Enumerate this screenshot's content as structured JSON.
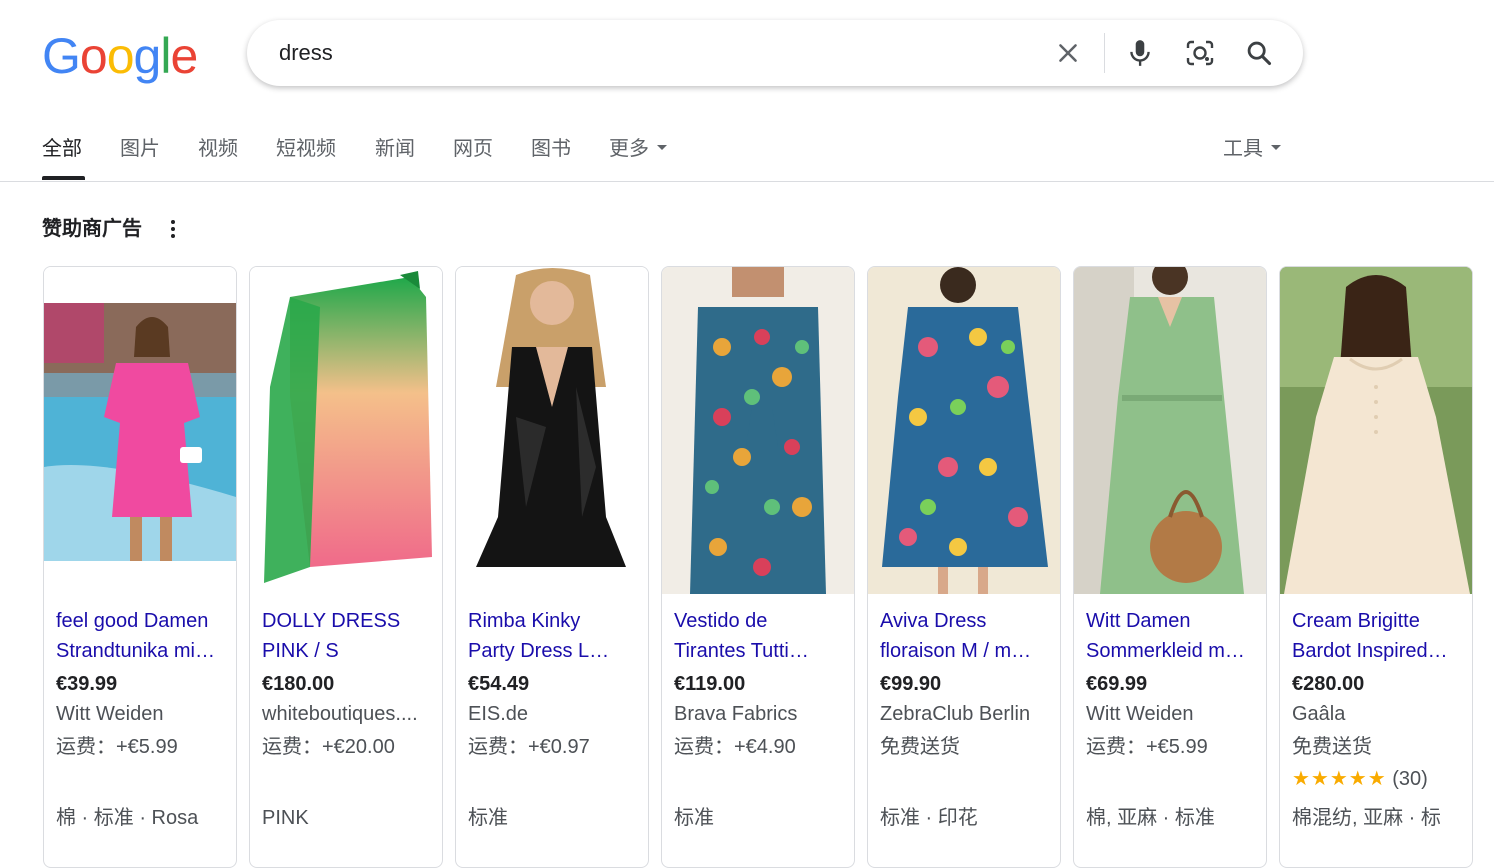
{
  "logo": {
    "letters": [
      "G",
      "o",
      "o",
      "g",
      "l",
      "e"
    ],
    "colors": [
      "#4285F4",
      "#EA4335",
      "#FBBC05",
      "#4285F4",
      "#34A853",
      "#EA4335"
    ]
  },
  "search": {
    "query": "dress",
    "clear_icon": "close-icon",
    "voice_icon": "mic-icon",
    "lens_icon": "lens-icon",
    "search_icon": "search-icon"
  },
  "tabs": [
    {
      "label": "全部",
      "active": true
    },
    {
      "label": "图片"
    },
    {
      "label": "视频"
    },
    {
      "label": "短视频"
    },
    {
      "label": "新闻"
    },
    {
      "label": "网页"
    },
    {
      "label": "图书"
    },
    {
      "label": "更多"
    }
  ],
  "tools_label": "工具",
  "sponsored_label": "赞助商广告",
  "products": [
    {
      "title1": "feel good Damen",
      "title2": "Strandtunika mi…",
      "price": "€39.99",
      "seller": "Witt Weiden",
      "shipping": "运费：+€5.99",
      "attrs": "棉 · 标准 · Rosa"
    },
    {
      "title1": "DOLLY DRESS",
      "title2": "PINK / S",
      "price": "€180.00",
      "seller": "whiteboutiques....",
      "shipping": "运费：+€20.00",
      "attrs": "PINK"
    },
    {
      "title1": "Rimba Kinky",
      "title2": "Party Dress L…",
      "price": "€54.49",
      "seller": "EIS.de",
      "shipping": "运费：+€0.97",
      "attrs": "标准"
    },
    {
      "title1": "Vestido de",
      "title2": "Tirantes Tutti…",
      "price": "€119.00",
      "seller": "Brava Fabrics",
      "shipping": "运费：+€4.90",
      "attrs": "标准"
    },
    {
      "title1": "Aviva Dress",
      "title2": "floraison M / m…",
      "price": "€99.90",
      "seller": "ZebraClub Berlin",
      "shipping": "免费送货",
      "attrs": "标准 · 印花"
    },
    {
      "title1": "Witt Damen",
      "title2": "Sommerkleid m…",
      "price": "€69.99",
      "seller": "Witt Weiden",
      "shipping": "运费：+€5.99",
      "attrs": "棉, 亚麻 · 标准"
    },
    {
      "title1": "Cream Brigitte",
      "title2": "Bardot Inspired…",
      "price": "€280.00",
      "seller": "Gaâla",
      "shipping": "免费送货",
      "stars": "★★★★★",
      "rating": 4.5,
      "rating_count": "(30)",
      "attrs": "棉混纺, 亚麻 · 标"
    }
  ],
  "colors": {
    "link": "#1a0dab",
    "text": "#202124",
    "secondary": "#4d5156",
    "star": "#f9ab00"
  }
}
